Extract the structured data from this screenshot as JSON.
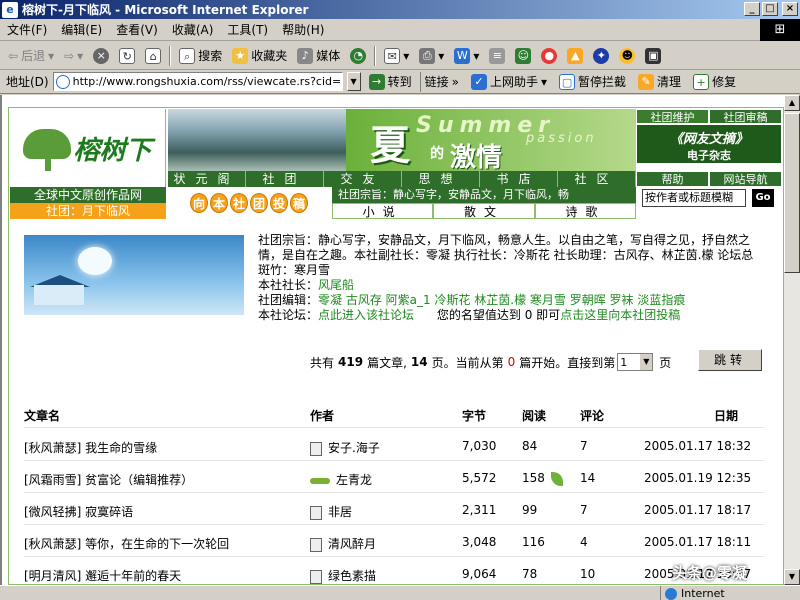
{
  "window": {
    "title": "榕树下-月下临风 - Microsoft Internet Explorer",
    "controls": [
      "_",
      "□",
      "×"
    ]
  },
  "menu": {
    "items": [
      "文件(F)",
      "编辑(E)",
      "查看(V)",
      "收藏(A)",
      "工具(T)",
      "帮助(H)"
    ]
  },
  "toolbar": {
    "back": "后退",
    "search": "搜索",
    "favorites": "收藏夹",
    "media": "媒体"
  },
  "addressbar": {
    "label": "地址(D)",
    "url": "http://www.rongshuxia.com/rss/viewcate.rs?cid=82",
    "go": "转到",
    "links": "链接",
    "helper": "上网助手",
    "popup_block": "暂停拦截",
    "clean": "清理",
    "repair": "修复"
  },
  "site": {
    "logo": "榕树下",
    "slogan": "全球中文原创作品网",
    "society_label": "社团：月下临风",
    "banner": {
      "xia": "夏",
      "summer": "Summer",
      "de": "的",
      "jiqing": "激情",
      "passion": "passion"
    },
    "nav": [
      "状元阁",
      "社团",
      "交友",
      "思想",
      "书店",
      "社区"
    ],
    "right_panel": {
      "maintain": "社团维护",
      "review": "社团审稿",
      "magazine_title": "《网友文摘》",
      "magazine_sub": "电子杂志",
      "help": "帮助",
      "guide": "网站导航"
    },
    "submit_chars": [
      "向",
      "本",
      "社",
      "团",
      "投",
      "稿"
    ],
    "motto_bar": "社团宗旨：静心写字，安静品文，月下临风，畅",
    "sub_nav": [
      "小说",
      "散文",
      "诗歌"
    ],
    "search_placeholder": "按作者或标题模糊",
    "search_go": "Go"
  },
  "info": {
    "line1": "社团宗旨：静心写字，安静品文，月下临风，畅意人生。以自由之笔，写自得之见，抒自然之情，是自在之趣。本社副社长：零凝 执行社长：冷斯花 社长助理：古风存、林芷茵.檬 论坛总斑竹：寒月雪",
    "leader_label": "本社社长：",
    "leader": "风尾船",
    "editors_label": "社团编辑：",
    "editors": "零凝 古风存 阿紫a_1 冷斯花 林芷茵.檬 寒月雪 罗朝晖 罗袜 淡蓝指痕",
    "forum_label": "本社论坛：",
    "forum_link": "点此进入该社论坛",
    "reputation": "您的名望值达到 0 即可",
    "submit_link": "点击这里向本社团投稿"
  },
  "pager": {
    "prefix": "共有",
    "articles": "419",
    "articles_unit": "篇文章,",
    "pages": "14",
    "pages_unit": "页。当前从第",
    "start": "0",
    "start_suffix": "篇开始。直接到第",
    "selected_page": "1",
    "page_unit": "页",
    "jump": "跳转"
  },
  "list": {
    "headers": {
      "title": "文章名",
      "author": "作者",
      "bytes": "字节",
      "reads": "阅读",
      "comments": "评论",
      "date": "日期"
    },
    "rows": [
      {
        "title": "[秋风萧瑟] 我生命的雪缘",
        "author": "安子.海子",
        "bytes": "7,030",
        "reads": "84",
        "comments": "7",
        "date": "2005.01.17 18:32"
      },
      {
        "title": "[风霜雨雪] 贫富论（编辑推荐）",
        "author": "左青龙",
        "bytes": "5,572",
        "reads": "158",
        "comments": "14",
        "date": "2005.01.19 12:35"
      },
      {
        "title": "[微风轻拂] 寂寞碎语",
        "author": "非居",
        "bytes": "2,311",
        "reads": "99",
        "comments": "7",
        "date": "2005.01.17 18:17"
      },
      {
        "title": "[秋风萧瑟] 等你，在生命的下一次轮回",
        "author": "清风醉月",
        "bytes": "3,048",
        "reads": "116",
        "comments": "4",
        "date": "2005.01.17 18:11"
      },
      {
        "title": "[明月清风] 邂逅十年前的春天",
        "author": "绿色素描",
        "bytes": "9,064",
        "reads": "78",
        "comments": "10",
        "date": "2005.01.17 18:07"
      }
    ]
  },
  "status": {
    "zone": "Internet",
    "watermark": "头条@零凝"
  }
}
